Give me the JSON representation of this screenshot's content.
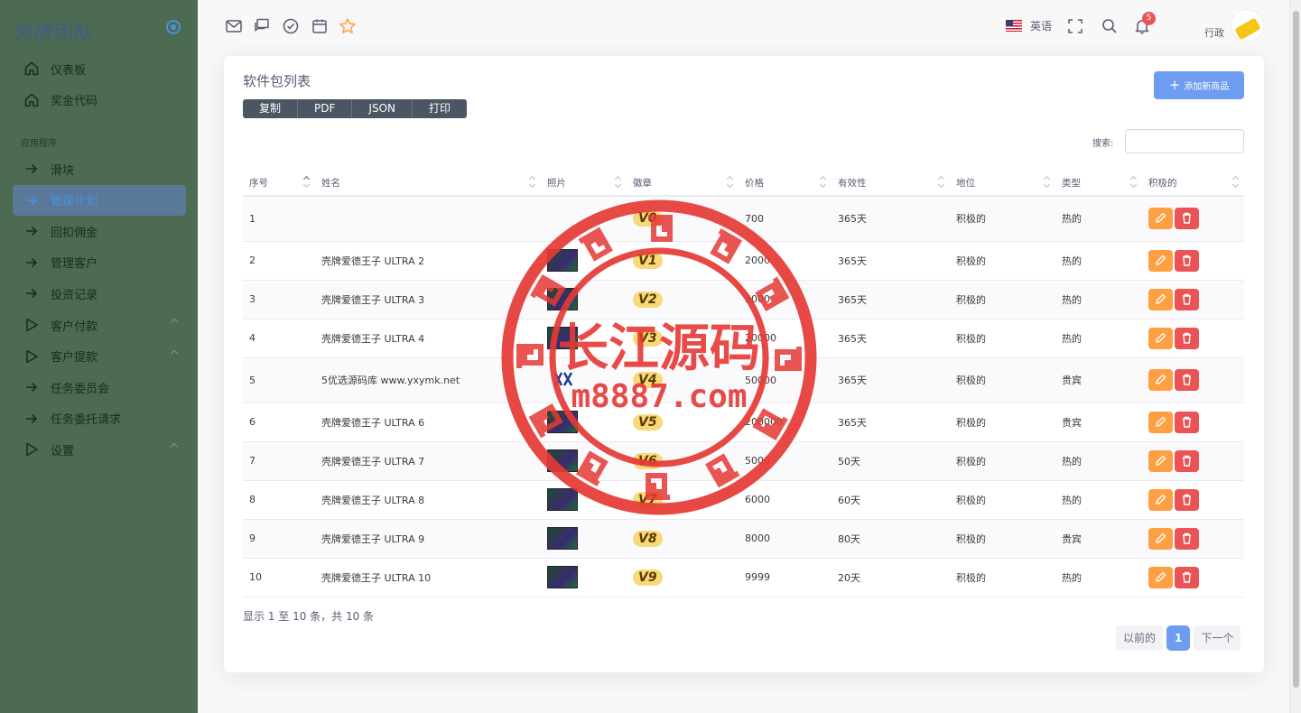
{
  "brand": {
    "name": "壳牌团队"
  },
  "sidebar": {
    "items": [
      {
        "label": "仪表板",
        "icon": "home-icon"
      },
      {
        "label": "奖金代码",
        "icon": "home-icon"
      }
    ],
    "section_label": "应用程序",
    "app_items": [
      {
        "label": "滑块",
        "icon": "arrow-right-icon"
      },
      {
        "label": "管理计划",
        "icon": "arrow-right-icon",
        "active": true
      },
      {
        "label": "回扣佣金",
        "icon": "arrow-right-icon"
      },
      {
        "label": "管理客户",
        "icon": "arrow-right-icon"
      },
      {
        "label": "投资记录",
        "icon": "arrow-right-icon"
      },
      {
        "label": "客户付款",
        "icon": "play-icon",
        "expandable": true
      },
      {
        "label": "客户提款",
        "icon": "play-icon",
        "expandable": true
      },
      {
        "label": "任务委员会",
        "icon": "arrow-right-icon"
      },
      {
        "label": "任务委托请求",
        "icon": "arrow-right-icon"
      },
      {
        "label": "设置",
        "icon": "play-icon",
        "expandable": true
      }
    ]
  },
  "topbar": {
    "shortcuts": [
      "mail-icon",
      "chat-icon",
      "check-circle-icon",
      "calendar-icon",
      "star-icon"
    ],
    "language": "英语",
    "notification_count": "5",
    "user_name": "行政"
  },
  "card": {
    "title": "软件包列表",
    "export_buttons": [
      "复制",
      "PDF",
      "JSON",
      "打印"
    ],
    "add_button": "添加新商品",
    "search_label": "搜索:",
    "search_value": ""
  },
  "table": {
    "columns": [
      "序号",
      "姓名",
      "照片",
      "徽章",
      "价格",
      "有效性",
      "地位",
      "类型",
      "积极的"
    ],
    "rows": [
      {
        "no": "1",
        "name": "",
        "photo": "none",
        "badge": "V0",
        "price": "700",
        "validity": "365天",
        "status": "积极的",
        "type": "热的"
      },
      {
        "no": "2",
        "name": "壳牌爱德王子 ULTRA 2",
        "photo": "image",
        "badge": "V1",
        "price": "2000",
        "validity": "365天",
        "status": "积极的",
        "type": "热的"
      },
      {
        "no": "3",
        "name": "壳牌爱德王子 ULTRA 3",
        "photo": "image",
        "badge": "V2",
        "price": "5000",
        "validity": "365天",
        "status": "积极的",
        "type": "热的"
      },
      {
        "no": "4",
        "name": "壳牌爱德王子 ULTRA 4",
        "photo": "image",
        "badge": "V3",
        "price": "20000",
        "validity": "365天",
        "status": "积极的",
        "type": "热的"
      },
      {
        "no": "5",
        "name": "5优选源码库 www.yxymk.net",
        "photo": "logo",
        "badge": "V4",
        "price": "50000",
        "validity": "365天",
        "status": "积极的",
        "type": "贵宾"
      },
      {
        "no": "6",
        "name": "壳牌爱德王子 ULTRA 6",
        "photo": "image",
        "badge": "V5",
        "price": "200000",
        "validity": "365天",
        "status": "积极的",
        "type": "贵宾"
      },
      {
        "no": "7",
        "name": "壳牌爱德王子 ULTRA 7",
        "photo": "image",
        "badge": "V6",
        "price": "5000",
        "validity": "50天",
        "status": "积极的",
        "type": "热的"
      },
      {
        "no": "8",
        "name": "壳牌爱德王子 ULTRA 8",
        "photo": "image",
        "badge": "V7",
        "price": "6000",
        "validity": "60天",
        "status": "积极的",
        "type": "热的"
      },
      {
        "no": "9",
        "name": "壳牌爱德王子 ULTRA 9",
        "photo": "image",
        "badge": "V8",
        "price": "8000",
        "validity": "80天",
        "status": "积极的",
        "type": "贵宾"
      },
      {
        "no": "10",
        "name": "壳牌爱德王子 ULTRA 10",
        "photo": "image",
        "badge": "V9",
        "price": "9999",
        "validity": "20天",
        "status": "积极的",
        "type": "热的"
      }
    ],
    "info": "显示 1 至 10 条，共 10 条"
  },
  "pagination": {
    "prev": "以前的",
    "current": "1",
    "next": "下一个"
  },
  "watermark": {
    "line1": "长江源码",
    "line2": "m8887.com",
    "color": "#e53935"
  },
  "colors": {
    "sidebar_bg": "#4d6b50",
    "primary": "#6e9cf0",
    "edit": "#ff9f43",
    "delete": "#ea5455",
    "badge": "#f8d97a"
  }
}
